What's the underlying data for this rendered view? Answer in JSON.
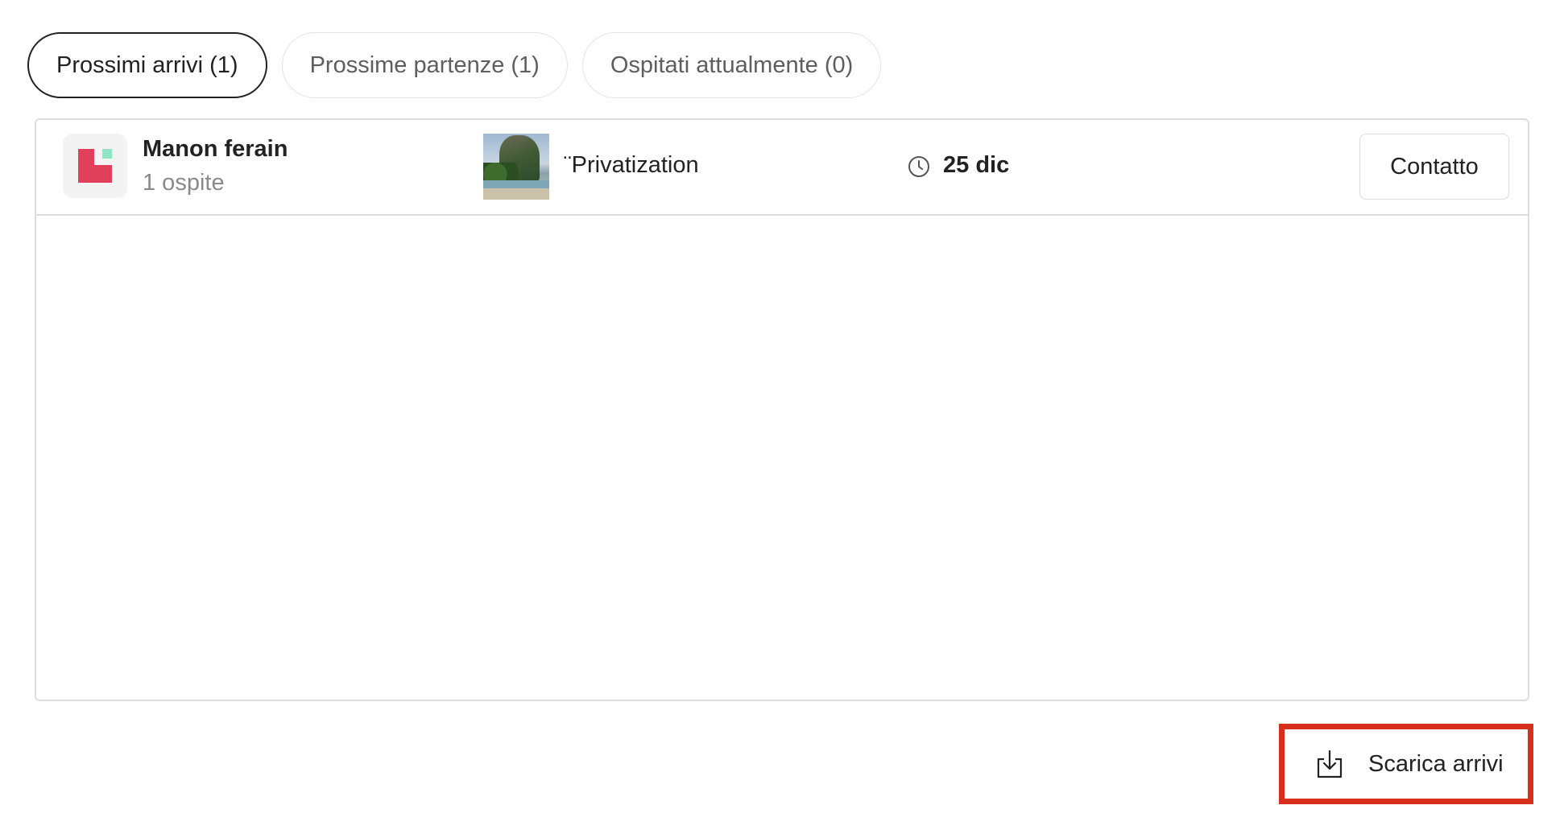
{
  "tabs": [
    {
      "label": "Prossimi arrivi (1)",
      "active": true
    },
    {
      "label": "Prossime partenze (1)",
      "active": false
    },
    {
      "label": "Ospitati attualmente (0)",
      "active": false
    }
  ],
  "reservations": [
    {
      "guest_name": "Manon ferain",
      "guest_count": "1 ospite",
      "listing_name": "¨Privatization",
      "date": "25 dic",
      "contact_label": "Contatto"
    }
  ],
  "download": {
    "label": "Scarica arrivi"
  },
  "colors": {
    "highlight_border": "#d62f1c",
    "avatar_red": "#e1405a",
    "avatar_mint": "#8ee6c4"
  },
  "icons": {
    "clock": "clock-icon",
    "download": "download-icon"
  }
}
